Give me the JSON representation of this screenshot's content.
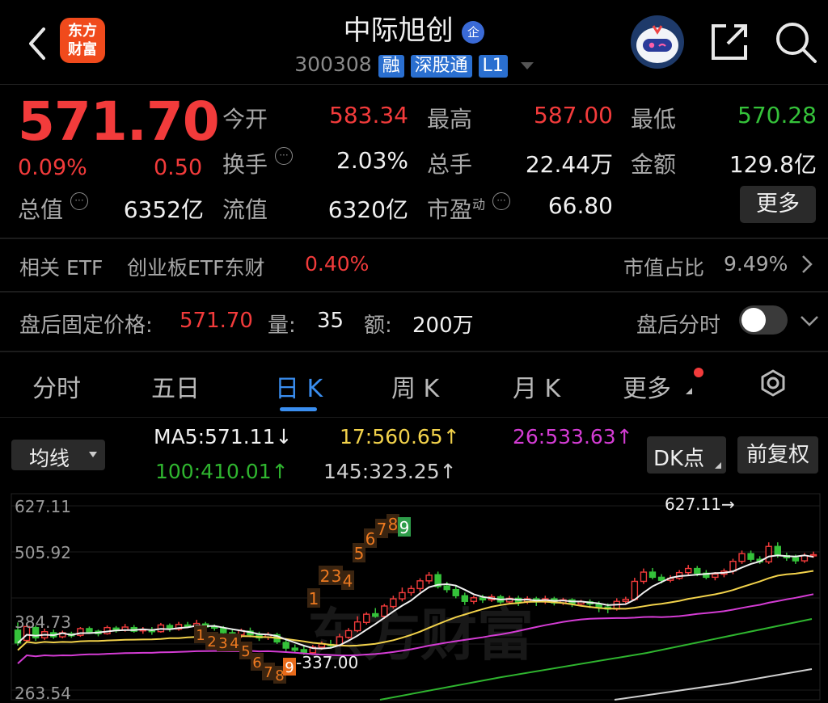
{
  "header": {
    "logo_line1": "东方",
    "logo_line2": "财富",
    "stock_name": "中际旭创",
    "name_badge": "企",
    "stock_code": "300308",
    "badges": [
      "融",
      "深股通",
      "L1"
    ]
  },
  "quote": {
    "price": "571.70",
    "change_pct": "0.09%",
    "change_abs": "0.50",
    "open_label": "今开",
    "open_value": "583.34",
    "high_label": "最高",
    "high_value": "587.00",
    "low_label": "最低",
    "low_value": "570.28",
    "turnover_label": "换手",
    "turnover_value": "2.03%",
    "volume_label": "总手",
    "volume_value": "22.44万",
    "amount_label": "金额",
    "amount_value": "129.8亿",
    "mktcap_label": "总值",
    "mktcap_value": "6352亿",
    "float_label": "流值",
    "float_value": "6320亿",
    "pe_label": "市盈",
    "pe_sup": "动",
    "pe_value": "66.80",
    "more_button": "更多"
  },
  "etf": {
    "label": "相关 ETF",
    "name": "创业板ETF东财",
    "pct": "0.40%",
    "share_label": "市值占比",
    "share_value": "9.49%"
  },
  "after_hours": {
    "label": "盘后固定价格:",
    "price": "571.70",
    "vol_label": "量:",
    "vol_value": "35",
    "amt_label": "额:",
    "amt_value": "200万",
    "intraday_label": "盘后分时"
  },
  "tabs": [
    "分时",
    "五日",
    "日 K",
    "周 K",
    "月 K",
    "更多"
  ],
  "active_tab": 2,
  "indicator": {
    "selector": "均线",
    "ma5": "MA5:571.11",
    "ma17": "17:560.65",
    "ma26": "26:533.63",
    "ma100": "100:410.01",
    "ma145": "145:323.25",
    "dk_button": "DK点",
    "adjust_button": "前复权"
  },
  "colors": {
    "up": "#f23b3b",
    "down": "#35c23a",
    "ma5": "#f0f0f0",
    "ma17": "#f2d24b",
    "ma26": "#d43cd4",
    "ma100": "#2fb52f",
    "ma145": "#cfcfcf",
    "accent": "#3a8ef0"
  },
  "chart_data": {
    "type": "candlestick",
    "y_ticks": [
      "627.11",
      "505.92",
      "384.73",
      "263.54"
    ],
    "max_label": "627.11",
    "min_label": "337.00",
    "watermark": "东方财富",
    "nine_turn_down": [
      "1",
      "2",
      "3",
      "4",
      "5",
      "6",
      "7",
      "8",
      "9"
    ],
    "nine_turn_up": [
      "1",
      "2",
      "3",
      "4",
      "5",
      "6",
      "7",
      "8",
      "9"
    ],
    "candles": [
      [
        385,
        360,
        400,
        355
      ],
      [
        365,
        392,
        398,
        360
      ],
      [
        390,
        370,
        394,
        364
      ],
      [
        370,
        382,
        388,
        366
      ],
      [
        380,
        372,
        386,
        368
      ],
      [
        372,
        380,
        384,
        369
      ],
      [
        378,
        374,
        382,
        370
      ],
      [
        375,
        388,
        391,
        372
      ],
      [
        388,
        382,
        392,
        379
      ],
      [
        383,
        378,
        386,
        373
      ],
      [
        378,
        390,
        394,
        376
      ],
      [
        389,
        384,
        393,
        380
      ],
      [
        385,
        391,
        397,
        382
      ],
      [
        390,
        383,
        395,
        380
      ],
      [
        384,
        386,
        391,
        378
      ],
      [
        386,
        382,
        391,
        376
      ],
      [
        382,
        395,
        399,
        380
      ],
      [
        394,
        387,
        398,
        382
      ],
      [
        387,
        396,
        401,
        384
      ],
      [
        395,
        392,
        401,
        389
      ],
      [
        392,
        398,
        405,
        390
      ],
      [
        397,
        391,
        401,
        386
      ],
      [
        392,
        389,
        396,
        384
      ],
      [
        389,
        380,
        393,
        374
      ],
      [
        380,
        376,
        388,
        372
      ],
      [
        376,
        384,
        388,
        370
      ],
      [
        383,
        376,
        390,
        371
      ],
      [
        376,
        370,
        382,
        364
      ],
      [
        371,
        376,
        381,
        366
      ],
      [
        376,
        362,
        380,
        358
      ],
      [
        361,
        350,
        366,
        344
      ],
      [
        350,
        346,
        357,
        341
      ],
      [
        347,
        340,
        354,
        337
      ],
      [
        341,
        352,
        356,
        338
      ],
      [
        352,
        358,
        363,
        347
      ],
      [
        357,
        356,
        366,
        351
      ],
      [
        356,
        372,
        378,
        353
      ],
      [
        371,
        384,
        389,
        368
      ],
      [
        384,
        401,
        412,
        381
      ],
      [
        400,
        416,
        420,
        396
      ],
      [
        417,
        412,
        428,
        409
      ],
      [
        412,
        432,
        436,
        407
      ],
      [
        431,
        446,
        452,
        427
      ],
      [
        446,
        458,
        468,
        441
      ],
      [
        458,
        466,
        472,
        452
      ],
      [
        466,
        481,
        486,
        460
      ],
      [
        481,
        492,
        498,
        475
      ],
      [
        493,
        470,
        499,
        466
      ],
      [
        471,
        464,
        479,
        458
      ],
      [
        464,
        452,
        472,
        447
      ],
      [
        452,
        441,
        458,
        434
      ],
      [
        441,
        448,
        452,
        436
      ],
      [
        448,
        444,
        454,
        438
      ],
      [
        444,
        450,
        455,
        440
      ],
      [
        450,
        440,
        454,
        436
      ],
      [
        440,
        447,
        452,
        436
      ],
      [
        447,
        440,
        452,
        432
      ],
      [
        440,
        446,
        451,
        436
      ],
      [
        446,
        440,
        450,
        432
      ],
      [
        440,
        446,
        452,
        436
      ],
      [
        446,
        438,
        450,
        433
      ],
      [
        438,
        444,
        448,
        434
      ],
      [
        444,
        436,
        447,
        430
      ],
      [
        436,
        440,
        444,
        432
      ],
      [
        440,
        436,
        445,
        428
      ],
      [
        436,
        430,
        441,
        420
      ],
      [
        430,
        426,
        437,
        418
      ],
      [
        426,
        441,
        447,
        423
      ],
      [
        441,
        445,
        450,
        437
      ],
      [
        445,
        480,
        487,
        442
      ],
      [
        480,
        498,
        505,
        475
      ],
      [
        498,
        488,
        506,
        484
      ],
      [
        488,
        482,
        494,
        476
      ],
      [
        482,
        486,
        492,
        478
      ],
      [
        486,
        497,
        502,
        483
      ],
      [
        497,
        505,
        512,
        492
      ],
      [
        505,
        496,
        510,
        490
      ],
      [
        496,
        488,
        502,
        484
      ],
      [
        488,
        494,
        498,
        482
      ],
      [
        494,
        500,
        505,
        488
      ],
      [
        500,
        519,
        524,
        494
      ],
      [
        519,
        534,
        540,
        514
      ],
      [
        534,
        523,
        540,
        518
      ],
      [
        523,
        518,
        529,
        514
      ],
      [
        518,
        548,
        556,
        514
      ],
      [
        548,
        530,
        556,
        526
      ],
      [
        530,
        526,
        536,
        520
      ],
      [
        526,
        520,
        532,
        514
      ],
      [
        520,
        530,
        535,
        516
      ],
      [
        530,
        532,
        538,
        526
      ]
    ]
  }
}
